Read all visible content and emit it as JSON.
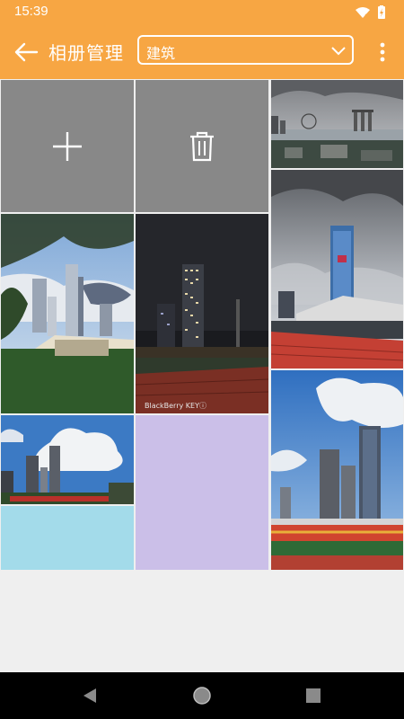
{
  "status_bar": {
    "time": "15:39",
    "icons": [
      "wifi-icon",
      "battery-icon"
    ]
  },
  "app_bar": {
    "title": "相册管理",
    "album_select": {
      "value": "建筑"
    },
    "icons": {
      "back": "arrow-left-icon",
      "dropdown": "chevron-down-icon",
      "more": "more-vert-icon"
    }
  },
  "grid": {
    "actions": [
      {
        "name": "add-photo",
        "icon": "plus-icon"
      },
      {
        "name": "delete-photo",
        "icon": "trash-icon"
      }
    ],
    "photos": [
      {
        "subject": "city skyline with bay and ferris wheel"
      },
      {
        "subject": "stadium with blue skyscraper"
      },
      {
        "subject": "skyscrapers behind trees and lawn"
      },
      {
        "subject": "night skyscrapers by stadium track",
        "watermark": "BlackBerry KEYⓘ"
      },
      {
        "subject": "skyscrapers with clouds"
      },
      {
        "subject": "stadium seats and towers"
      }
    ],
    "placeholders": [
      {
        "color": "#cbbfe8"
      },
      {
        "color": "#a3dbea"
      }
    ]
  },
  "nav_bar": {
    "icons": [
      "back-triangle-icon",
      "home-circle-icon",
      "recents-square-icon"
    ]
  },
  "colors": {
    "accent": "#f7a643",
    "action_tile": "#888888",
    "background": "#efefef"
  }
}
